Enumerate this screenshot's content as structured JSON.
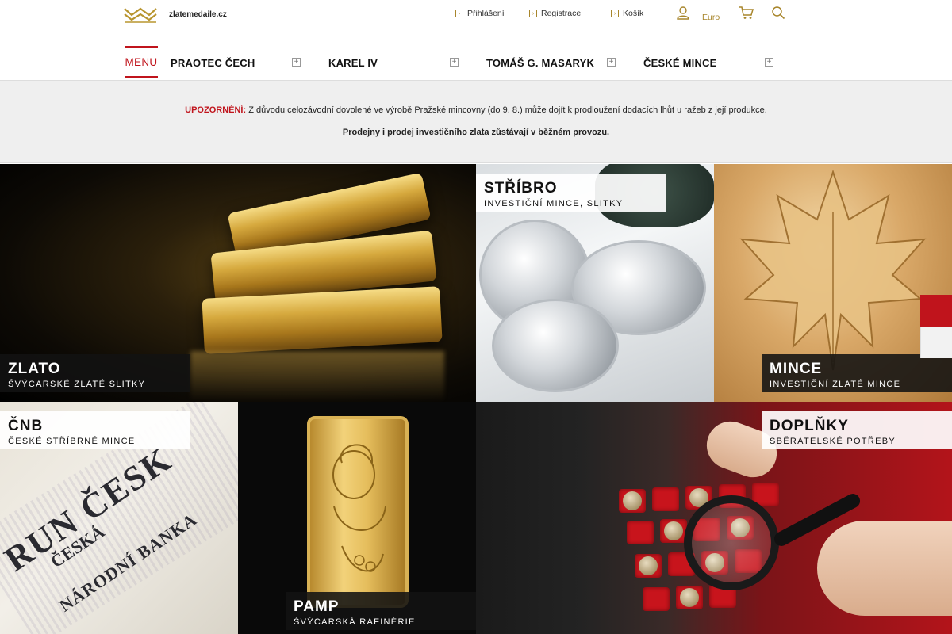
{
  "header": {
    "logo_text": "zlatemedaile.cz",
    "links": {
      "login": "Přihlášení",
      "register": "Registrace",
      "cart": "Košík"
    },
    "currency": "Euro"
  },
  "nav": {
    "menu_label": "MENU",
    "items": [
      "PRAOTEC ČECH",
      "KAREL IV",
      "TOMÁŠ G. MASARYK",
      "ČESKÉ MINCE"
    ],
    "plus": "+"
  },
  "notice": {
    "warning_label": "UPOZORNĚNÍ:",
    "warning_text": " Z důvodu celozávodní dovolené ve výrobě Pražské mincovny (do 9. 8.) může dojít k prodloužení dodacích lhůt u ražeb z její produkce.",
    "line2": "Prodejny i prodej investičního zlata zůstávají v běžném provozu."
  },
  "tiles": {
    "zlato": {
      "title": "ZLATO",
      "subtitle": "ŠVÝCARSKÉ ZLATÉ SLITKY"
    },
    "stribro": {
      "title": "STŘÍBRO",
      "subtitle": "INVESTIČNÍ MINCE, SLITKY"
    },
    "mince": {
      "title": "MINCE",
      "subtitle": "INVESTIČNÍ ZLATÉ MINCE"
    },
    "cnb": {
      "title": "ČNB",
      "subtitle": "ČESKÉ STŘÍBRNÉ MINCE"
    },
    "pamp": {
      "title": "PAMP",
      "subtitle": "ŠVÝCARSKÁ RAFINÉRIE"
    },
    "doplnky": {
      "title": "DOPLŇKY",
      "subtitle": "SBĚRATELSKÉ POTŘEBY"
    }
  },
  "colors": {
    "accent": "#c0141c",
    "gold": "#a8862c",
    "notice_bg": "#efefef"
  }
}
